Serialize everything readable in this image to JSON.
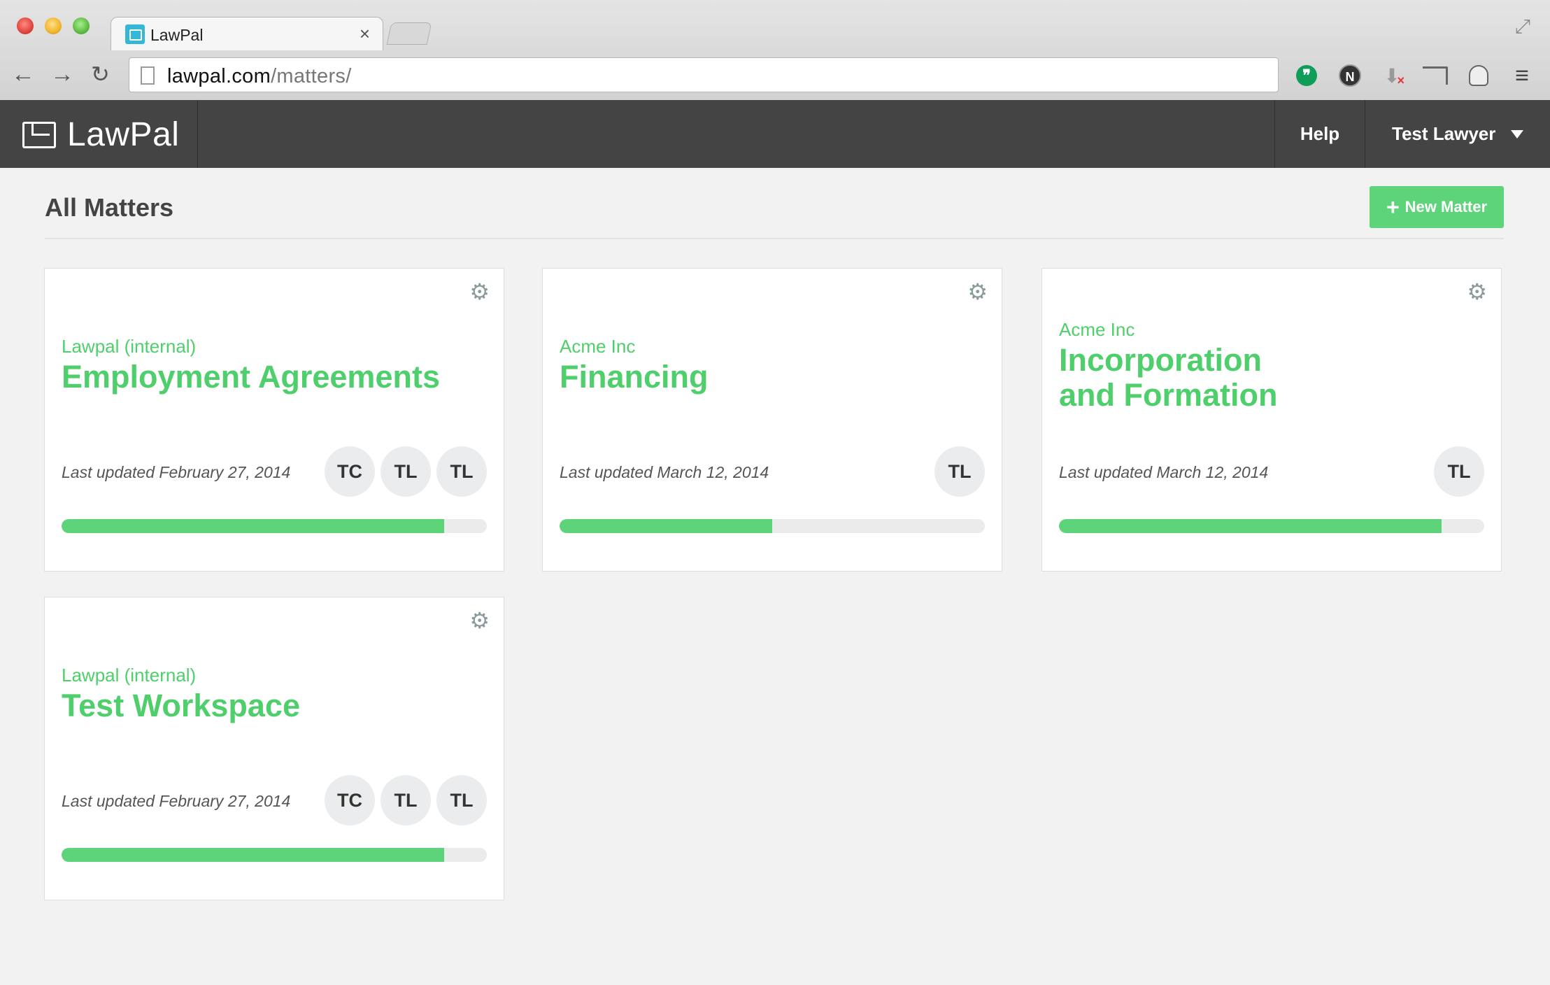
{
  "browser": {
    "tab_title": "LawPal",
    "tab_close": "×",
    "url_domain": "lawpal.com",
    "url_path": "/matters/",
    "nav": {
      "back": "←",
      "forward": "→",
      "reload": "↻"
    },
    "menu_icon": "≡",
    "ext_hangouts": "❞",
    "ext_n": "N",
    "ext_download": "⬇",
    "ext_download_x": "×",
    "expand": "⤢"
  },
  "header": {
    "brand": "LawPal",
    "help": "Help",
    "user": "Test Lawyer"
  },
  "page": {
    "title": "All Matters",
    "new_matter_label": "New Matter",
    "new_matter_plus": "+"
  },
  "matters": [
    {
      "client": "Lawpal (internal)",
      "title": "Employment Agreements",
      "updated": "Last updated February 27, 2014",
      "members": [
        "TC",
        "TL",
        "TL"
      ],
      "progress": 0.9
    },
    {
      "client": "Acme Inc",
      "title": "Financing",
      "updated": "Last updated March 12, 2014",
      "members": [
        "TL"
      ],
      "progress": 0.5
    },
    {
      "client": "Acme Inc",
      "title_line1": "Incorporation",
      "title_line2": "and Formation",
      "updated": "Last updated March 12, 2014",
      "members": [
        "TL"
      ],
      "progress": 0.9
    },
    {
      "client": "Lawpal (internal)",
      "title": "Test Workspace",
      "updated": "Last updated February 27, 2014",
      "members": [
        "TC",
        "TL",
        "TL"
      ],
      "progress": 0.9
    }
  ],
  "icons": {
    "gear": "⚙"
  },
  "colors": {
    "accent": "#5ed47a",
    "header_bg": "#444444",
    "page_bg": "#f2f2f2"
  }
}
